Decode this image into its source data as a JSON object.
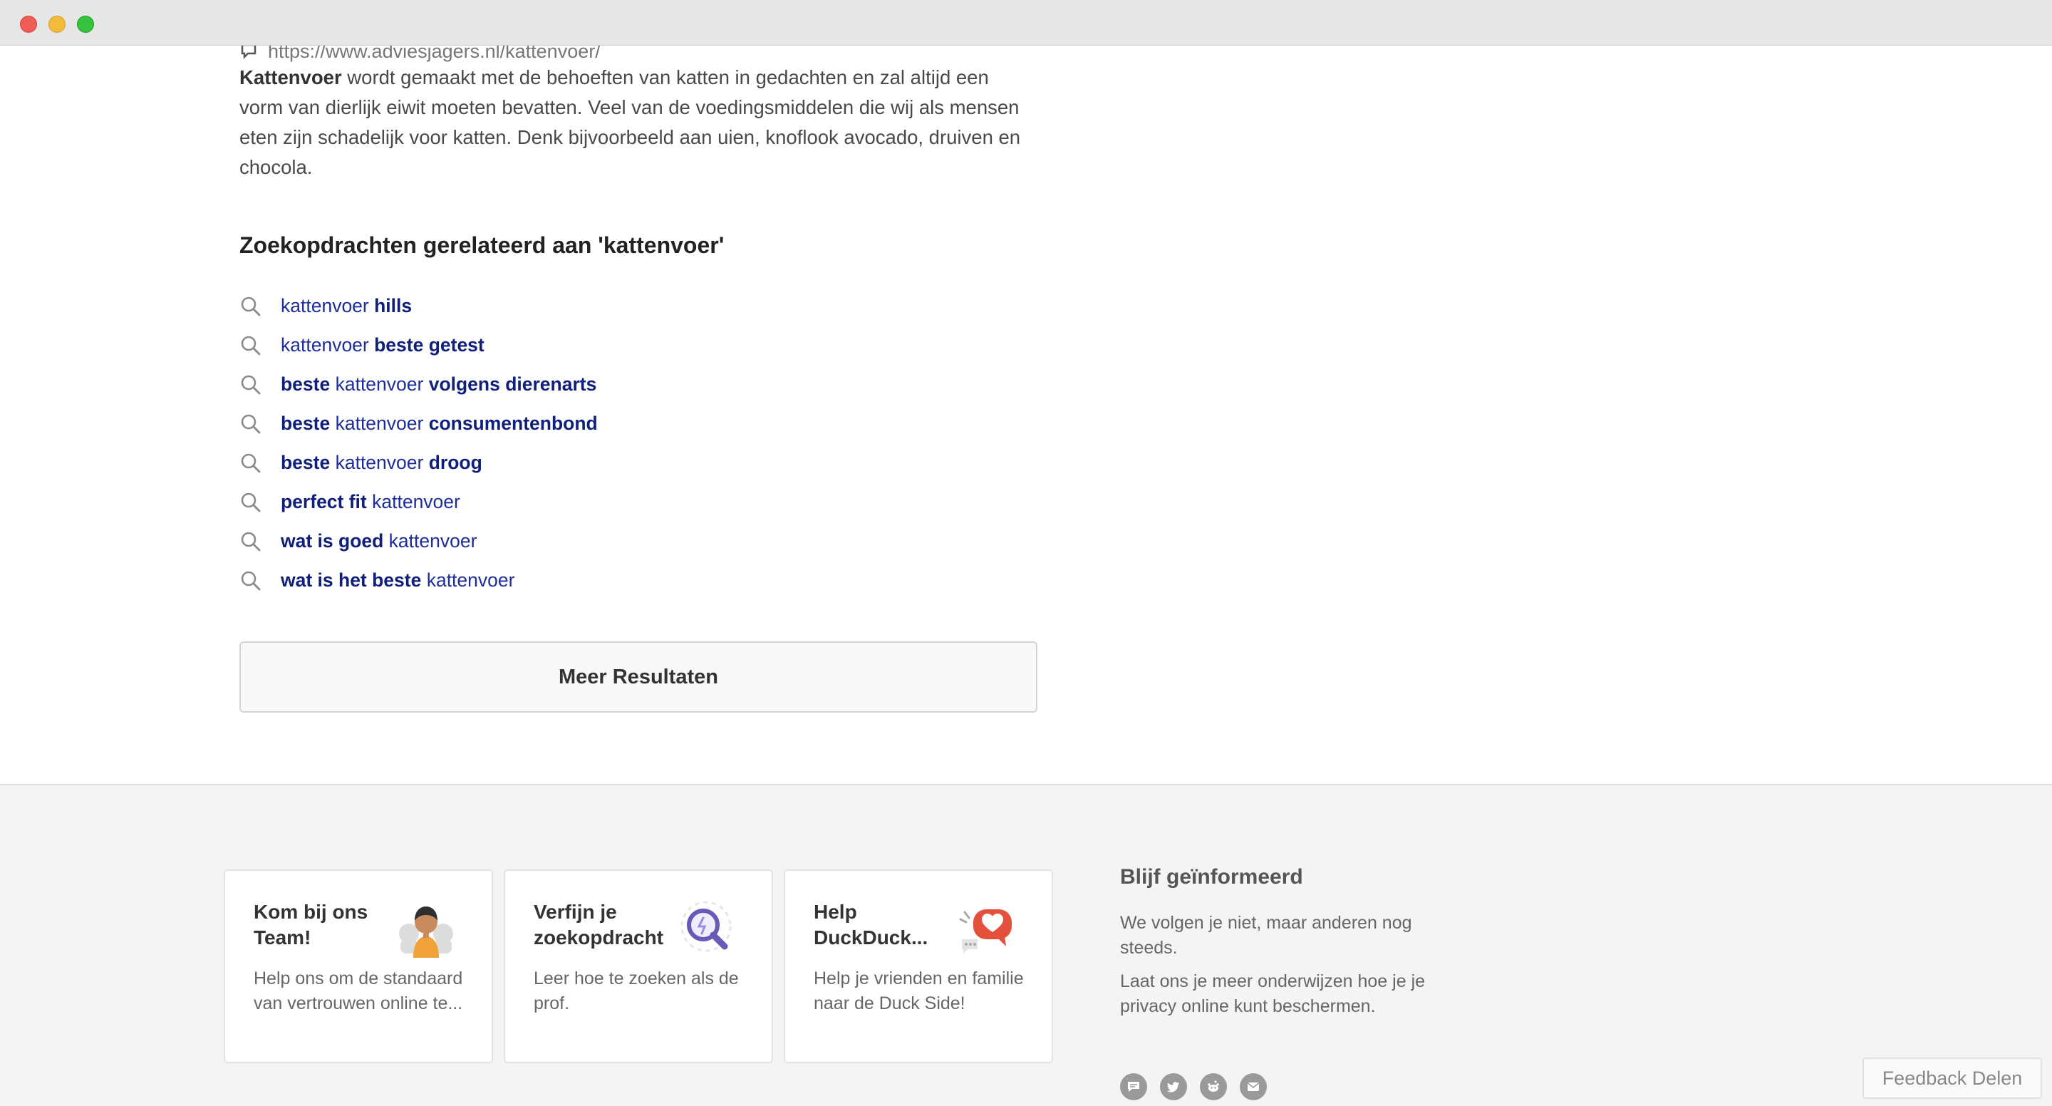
{
  "result": {
    "url": "https://www.adviesjagers.nl/kattenvoer/",
    "snippet_bold": "Kattenvoer",
    "snippet_rest": " wordt gemaakt met de behoeften van katten in gedachten en zal altijd een vorm van dierlijk eiwit moeten bevatten. Veel van de voedingsmiddelen die wij als mensen eten zijn schadelijk voor katten. Denk bijvoorbeeld aan uien, knoflook avocado, druiven en chocola."
  },
  "related": {
    "title": "Zoekopdrachten gerelateerd aan 'kattenvoer'",
    "items": [
      {
        "parts": [
          {
            "t": "kattenvoer ",
            "b": false
          },
          {
            "t": "hills",
            "b": true
          }
        ]
      },
      {
        "parts": [
          {
            "t": "kattenvoer ",
            "b": false
          },
          {
            "t": "beste getest",
            "b": true
          }
        ]
      },
      {
        "parts": [
          {
            "t": "beste",
            "b": true
          },
          {
            "t": " kattenvoer ",
            "b": false
          },
          {
            "t": "volgens dierenarts",
            "b": true
          }
        ]
      },
      {
        "parts": [
          {
            "t": "beste",
            "b": true
          },
          {
            "t": " kattenvoer ",
            "b": false
          },
          {
            "t": "consumentenbond",
            "b": true
          }
        ]
      },
      {
        "parts": [
          {
            "t": "beste",
            "b": true
          },
          {
            "t": " kattenvoer ",
            "b": false
          },
          {
            "t": "droog",
            "b": true
          }
        ]
      },
      {
        "parts": [
          {
            "t": "perfect fit",
            "b": true
          },
          {
            "t": " kattenvoer",
            "b": false
          }
        ]
      },
      {
        "parts": [
          {
            "t": "wat is goed",
            "b": true
          },
          {
            "t": " kattenvoer",
            "b": false
          }
        ]
      },
      {
        "parts": [
          {
            "t": "wat is het beste",
            "b": true
          },
          {
            "t": " kattenvoer",
            "b": false
          }
        ]
      }
    ]
  },
  "more_button": "Meer Resultaten",
  "footer": {
    "cards": [
      {
        "title": "Kom bij ons Team!",
        "desc": "Help ons om de standaard van vertrouwen online te...",
        "icon": "team-illustration-icon"
      },
      {
        "title": "Verfijn je zoekopdracht",
        "desc": "Leer hoe te zoeken als de prof.",
        "icon": "magnifier-illustration-icon"
      },
      {
        "title": "Help DuckDuck...",
        "desc": "Help je vrienden en familie naar de Duck Side!",
        "icon": "heart-bubble-illustration-icon"
      }
    ],
    "info": {
      "title": "Blijf geïnformeerd",
      "p1": "We volgen je niet, maar anderen nog steeds.",
      "p2": "Laat ons je meer onderwijzen hoe je je privacy online kunt beschermen."
    },
    "social": [
      "chat-icon",
      "twitter-icon",
      "reddit-icon",
      "mail-icon"
    ]
  },
  "feedback_button": "Feedback Delen",
  "colors": {
    "link": "#1d2e9a",
    "footer_bg": "#f4f4f4",
    "accent": "#de5833"
  }
}
